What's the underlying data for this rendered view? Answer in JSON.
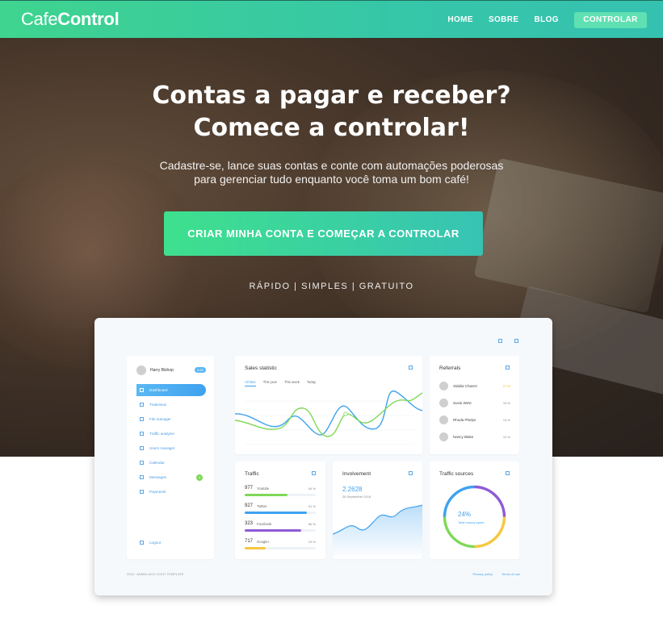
{
  "header": {
    "logo_part1": "Cafe",
    "logo_part2": "Control",
    "nav": [
      "HOME",
      "SOBRE",
      "BLOG"
    ],
    "cta": "CONTROLAR"
  },
  "hero": {
    "headline_line1": "Contas a pagar e receber?",
    "headline_line2": "Comece a controlar!",
    "sub_line1": "Cadastre-se, lance suas contas e conte com automações poderosas",
    "sub_line2": "para gerenciar tudo enquanto você toma um bom café!",
    "cta": "CRIAR MINHA CONTA E COMEÇAR A CONTROLAR",
    "tagline": "RÁPIDO | SIMPLES | GRATUITO"
  },
  "mockup": {
    "user": {
      "name": "Harry Bishop",
      "badge": "6.52"
    },
    "menu": [
      "Dashboard",
      "Tradeview",
      "File manager",
      "Traffic analyzer",
      "Users manager",
      "Calendar",
      "Messages",
      "Payments"
    ],
    "messages_badge": "4",
    "logout": "Logout",
    "sales": {
      "title": "Sales statistic",
      "tabs": [
        "All time",
        "This year",
        "This week",
        "Today"
      ]
    },
    "referrals": {
      "title": "Referrals",
      "rows": [
        {
          "name": "Sidalia Chavez",
          "value": "27.%"
        },
        {
          "name": "Susie West",
          "value": "19.%"
        },
        {
          "name": "Rhoda Phelps",
          "value": "14.%"
        },
        {
          "name": "Nancy Blake",
          "value": "12.%"
        }
      ]
    },
    "traffic": {
      "title": "Traffic",
      "rows": [
        {
          "value": "977",
          "label": "Youtube",
          "percent": "54 %",
          "fill": 0.6,
          "color": "#7ed957"
        },
        {
          "value": "927",
          "label": "Twitter",
          "percent": "91 %",
          "fill": 0.88,
          "color": "#3fa2ef"
        },
        {
          "value": "323",
          "label": "Facebook",
          "percent": "86 %",
          "fill": 0.8,
          "color": "#8e5bd6"
        },
        {
          "value": "717",
          "label": "Google+",
          "percent": "23 %",
          "fill": 0.3,
          "color": "#f5c842"
        }
      ]
    },
    "involvement": {
      "title": "Involvement",
      "value": "2.2628",
      "date": "26 September 2016"
    },
    "sources": {
      "title": "Traffic sources",
      "percent": "24%",
      "label": "Total money spent"
    },
    "footer_left": "2016 · ADMIN-KICK LIGHT TEMPLATE",
    "footer_links": [
      "Privacy policy",
      "Terms of use"
    ]
  }
}
